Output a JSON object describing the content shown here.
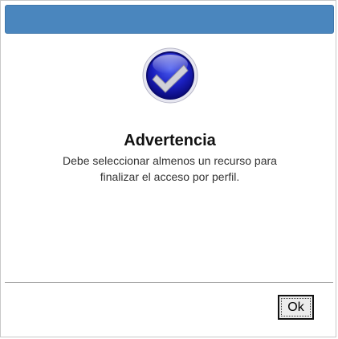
{
  "dialog": {
    "title_bar_color": "#4a86be",
    "icon": "check-badge-icon",
    "heading": "Advertencia",
    "message_line_1": "Debe seleccionar almenos un recurso para",
    "message_line_2": "finalizar el acceso por perfil.",
    "ok_label": "Ok"
  }
}
